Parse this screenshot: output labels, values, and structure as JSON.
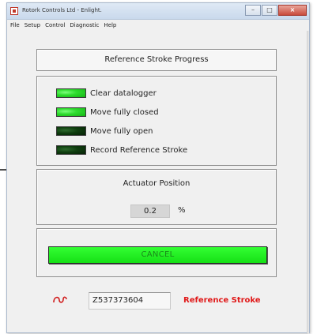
{
  "window": {
    "title": "Rotork Controls Ltd - Enlight.",
    "controls": {
      "minimize": "–",
      "maximize": "□",
      "close": "×"
    }
  },
  "menu": [
    "File",
    "Setup",
    "Control",
    "Diagnostic",
    "Help"
  ],
  "progress": {
    "title": "Reference Stroke Progress",
    "steps": [
      {
        "label": "Clear datalogger",
        "state": "on"
      },
      {
        "label": "Move fully closed",
        "state": "on"
      },
      {
        "label": "Move fully open",
        "state": "off"
      },
      {
        "label": "Record Reference Stroke",
        "state": "off"
      }
    ]
  },
  "actuator": {
    "title": "Actuator Position",
    "value": "0.2",
    "unit": "%"
  },
  "cancel_label": "CANCEL",
  "footer": {
    "serial": "Z537373604",
    "mode": "Reference Stroke",
    "logo_icon": "rotork-logo-icon"
  },
  "colors": {
    "led_on": "#2fdc2f",
    "led_off": "#0f3d0f",
    "cancel_bg": "#22ee22",
    "mode_text": "#e01818"
  }
}
